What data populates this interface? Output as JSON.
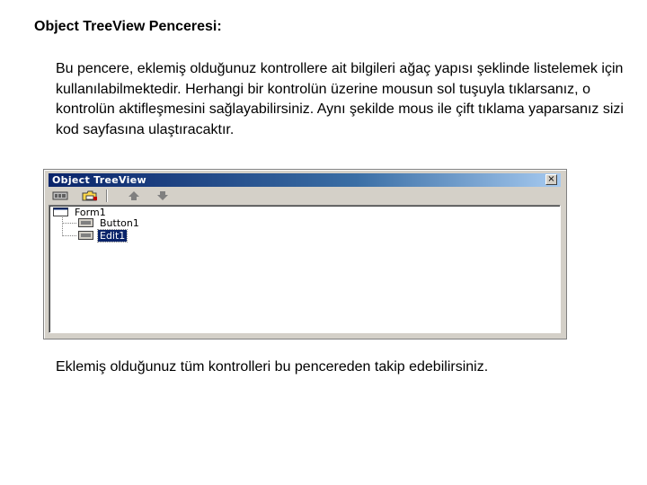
{
  "heading": "Object TreeView Penceresi:",
  "paragraph": "Bu pencere, eklemiş olduğunuz kontrollere ait bilgileri ağaç yapısı şeklinde listelemek için kullanılabilmektedir. Herhangi bir kontrolün üzerine mousun sol tuşuyla tıklarsanız, o kontrolün aktifleşmesini sağlayabilirsiniz. Aynı şekilde mous ile çift tıklama yaparsanız sizi kod sayfasına ulaştıracaktır.",
  "footer": "Eklemiş olduğunuz tüm kontrolleri bu pencereden takip edebilirsiniz.",
  "window": {
    "title": "Object TreeView",
    "close_label": "×",
    "toolbar": [
      {
        "icon": "properties-icon"
      },
      {
        "icon": "open-folder-icon"
      },
      {
        "icon": "arrow-up-icon"
      },
      {
        "icon": "arrow-down-icon"
      }
    ],
    "tree": [
      {
        "label": "Form1",
        "level": 0,
        "selected": false
      },
      {
        "label": "Button1",
        "level": 1,
        "selected": false
      },
      {
        "label": "Edit1",
        "level": 1,
        "selected": true
      }
    ]
  },
  "colors": {
    "title_active": "#0a246a",
    "face": "#d4d0c8",
    "selection": "#0a246a"
  }
}
